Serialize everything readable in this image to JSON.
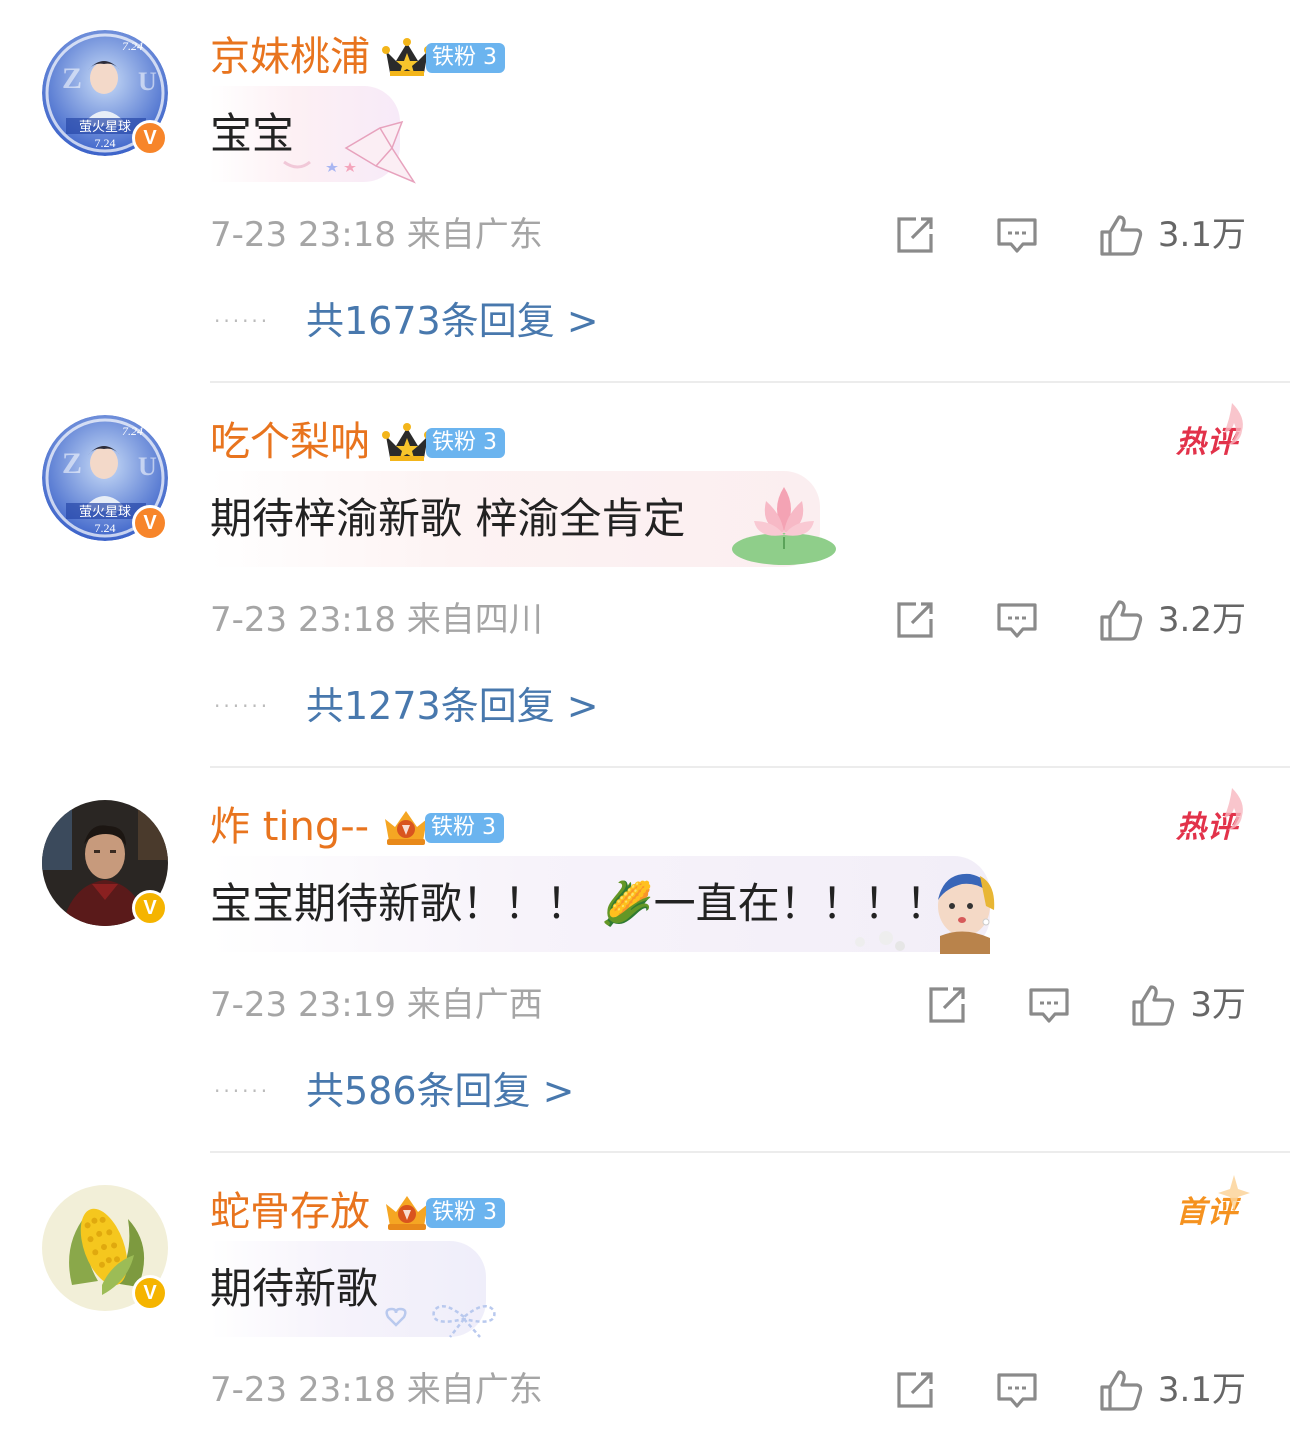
{
  "colors": {
    "username": "#e8741e",
    "link": "#4878ad",
    "meta": "#a5a5a5",
    "fan_tag": "#6bb4ef",
    "hot_badge": "#e2324a",
    "first_badge": "#f5921f"
  },
  "comments": [
    {
      "username": "京妹桃浦",
      "fan_badge": "铁粉 3",
      "text": "宝宝",
      "meta": "7-23 23:18  来自广东",
      "likes": "3.1万",
      "replies": "共1673条回复 >",
      "badge": "",
      "avatar": "zzu-poster-avatar",
      "verified": "V"
    },
    {
      "username": "吃个梨呐",
      "fan_badge": "铁粉 3",
      "text": "期待梓渝新歌 梓渝全肯定",
      "meta": "7-23 23:18  来自四川",
      "likes": "3.2万",
      "replies": "共1273条回复 >",
      "badge": "热评",
      "avatar": "zzu-poster-avatar",
      "verified": "V"
    },
    {
      "username": "炸 ting--",
      "fan_badge": "铁粉 3",
      "text": "宝宝期待新歌！！！ 🌽一直在！！！！",
      "meta": "7-23 23:19  来自广西",
      "likes": "3万",
      "replies": "共586条回复 >",
      "badge": "热评",
      "avatar": "man-portrait-avatar",
      "verified": "V"
    },
    {
      "username": "蛇骨存放",
      "fan_badge": "铁粉 3",
      "text": "期待新歌",
      "meta": "7-23 23:18  来自广东",
      "likes": "3.1万",
      "replies": "",
      "badge": "首评",
      "avatar": "corn-avatar",
      "verified": "V"
    }
  ],
  "avatar_texts": {
    "date": "7.24",
    "title": "萤火星球"
  }
}
